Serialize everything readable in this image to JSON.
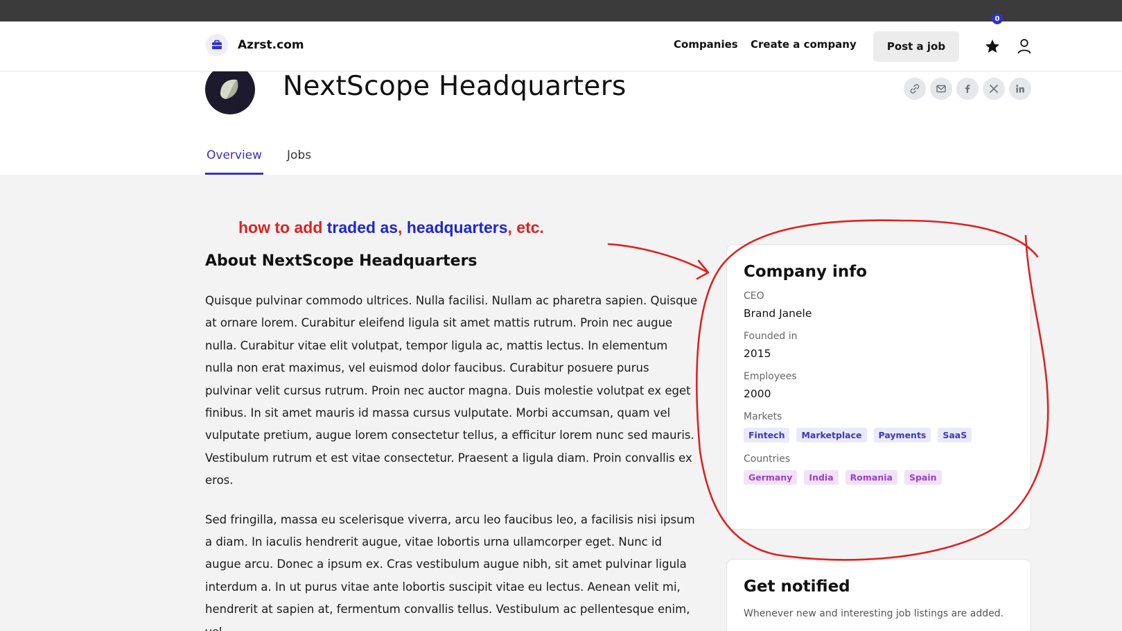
{
  "navbar": {
    "brand": "Azrst.com",
    "links": [
      "Companies",
      "Create a company"
    ],
    "post_job": "Post a job",
    "favorites_count": "0"
  },
  "company": {
    "name": "NextScope Headquarters"
  },
  "tabs": [
    {
      "label": "Overview",
      "active": true
    },
    {
      "label": "Jobs",
      "active": false
    }
  ],
  "annotation": {
    "part1": "how to add ",
    "part2": "traded as",
    "part3": ", ",
    "part4": "headquarters",
    "part5": ", etc."
  },
  "about": {
    "title": "About NextScope Headquarters",
    "paragraphs": [
      "Quisque pulvinar commodo ultrices. Nulla facilisi. Nullam ac pharetra sapien. Quisque at ornare lorem. Curabitur eleifend ligula sit amet mattis rutrum. Proin nec augue nulla. Curabitur vitae elit volutpat, tempor ligula ac, mattis lectus. In elementum nulla non erat maximus, vel euismod dolor faucibus. Curabitur posuere purus pulvinar velit cursus rutrum. Proin nec auctor magna. Duis molestie volutpat ex eget finibus. In sit amet mauris id massa cursus vulputate. Morbi accumsan, quam vel vulputate pretium, augue lorem consectetur tellus, a efficitur lorem nunc sed mauris. Vestibulum rutrum et est vitae consectetur. Praesent a ligula diam. Proin convallis ex eros.",
      "Sed fringilla, massa eu scelerisque viverra, arcu leo faucibus leo, a facilisis nisi ipsum a diam. In iaculis hendrerit augue, vitae lobortis urna ullamcorper eget. Nunc id augue arcu. Donec a ipsum ex. Cras vestibulum augue nibh, sit amet pulvinar ligula interdum a. In ut purus vitae ante lobortis suscipit vitae eu lectus. Aenean velit mi, hendrerit at sapien at, fermentum convallis tellus. Vestibulum ac pellentesque enim, vel"
    ]
  },
  "company_info": {
    "title": "Company info",
    "ceo_label": "CEO",
    "ceo": "Brand Janele",
    "founded_label": "Founded in",
    "founded": "2015",
    "employees_label": "Employees",
    "employees": "2000",
    "markets_label": "Markets",
    "markets": [
      "Fintech",
      "Marketplace",
      "Payments",
      "SaaS"
    ],
    "countries_label": "Countries",
    "countries": [
      "Germany",
      "India",
      "Romania",
      "Spain"
    ]
  },
  "notify": {
    "title": "Get notified",
    "description": "Whenever new and interesting job listings are added."
  },
  "colors": {
    "accent": "#3531c9",
    "annotation_red": "#e02020",
    "annotation_blue": "#1e25d8"
  }
}
